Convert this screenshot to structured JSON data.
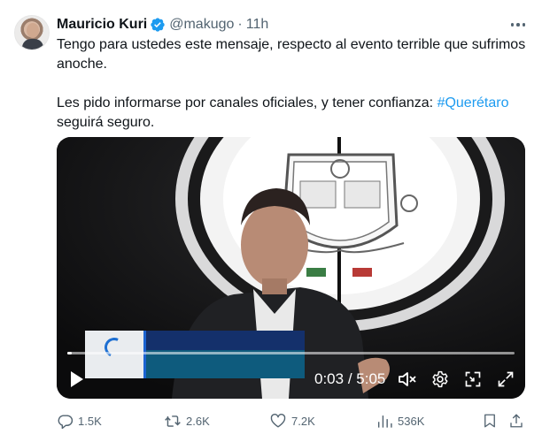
{
  "author": {
    "name": "Mauricio Kuri",
    "handle": "@makugo",
    "separator": "·",
    "time": "11h"
  },
  "body": {
    "line1": "Tengo para ustedes este mensaje, respecto al evento terrible que sufrimos anoche.",
    "line2_before": "Les pido informarse por canales oficiales, y tener confianza: ",
    "hashtag": "#Querétaro",
    "line2_after": " seguirá seguro."
  },
  "video": {
    "current_time": "0:03",
    "time_separator": " / ",
    "duration": "5:05",
    "progress_fraction": 0.01
  },
  "actions": {
    "replies": "1.5K",
    "reposts": "2.6K",
    "likes": "7.2K",
    "views": "536K"
  },
  "icons": {
    "verified": "verified-badge-icon",
    "more": "more-icon",
    "play": "play-icon",
    "mute": "mute-icon",
    "settings": "gear-icon",
    "pip": "picture-in-picture-icon",
    "fullscreen": "fullscreen-icon",
    "reply": "reply-icon",
    "repost": "repost-icon",
    "like": "heart-icon",
    "views": "views-icon",
    "bookmark": "bookmark-icon",
    "share": "share-icon"
  },
  "colors": {
    "text": "#0f1419",
    "muted": "#536471",
    "link": "#1d9bf0",
    "verified": "#1d9bf0"
  }
}
